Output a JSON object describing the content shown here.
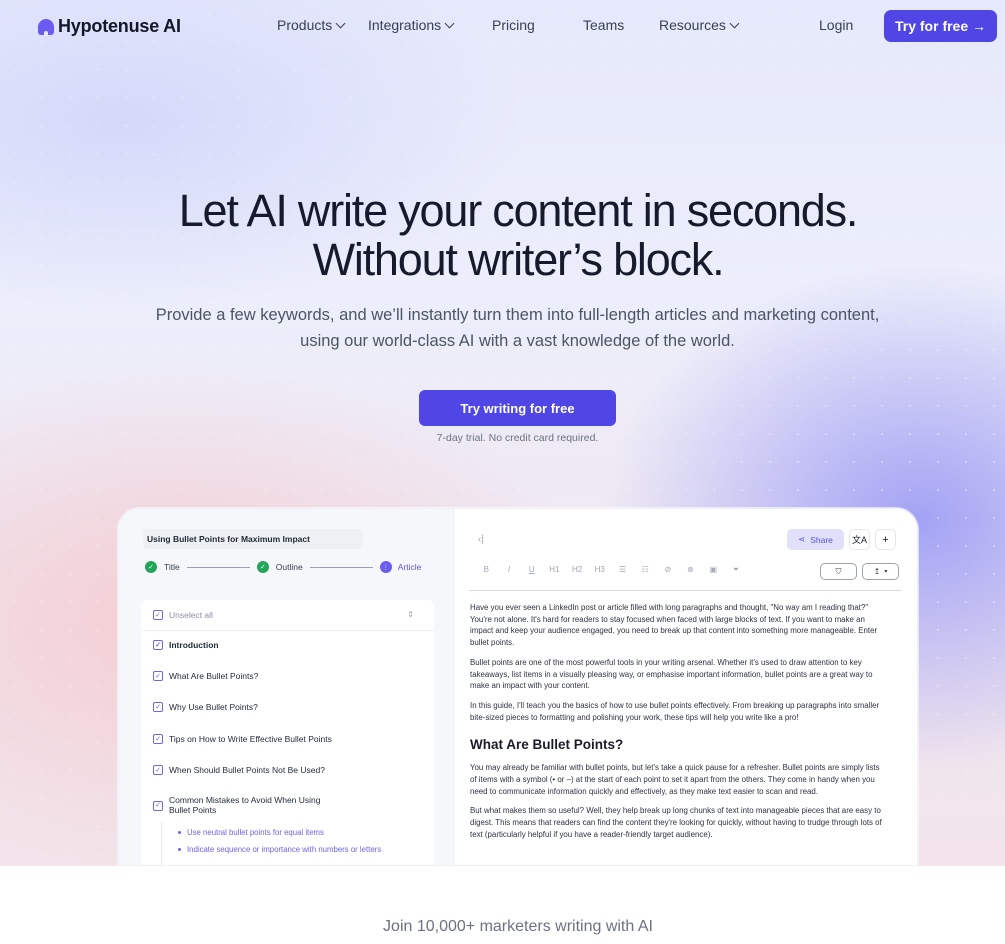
{
  "nav": {
    "logo_text": "Hypotenuse AI",
    "logo_icon": "hypotenuse-logo-icon",
    "items": [
      {
        "label": "Products",
        "dropdown": true
      },
      {
        "label": "Integrations",
        "dropdown": true
      },
      {
        "label": "Pricing",
        "dropdown": false
      },
      {
        "label": "Teams",
        "dropdown": false
      },
      {
        "label": "Resources",
        "dropdown": true
      }
    ],
    "login_label": "Login",
    "try_free_label": "Try for free →"
  },
  "hero": {
    "headline_line1": "Let AI write your content in seconds.",
    "headline_line2": "Without writer’s block.",
    "subhead": "Provide a few keywords, and we’ll instantly turn them into full-length articles and marketing content, using our world-class AI with a vast knowledge of the world.",
    "cta_label": "Try writing for free",
    "cta_note": "7-day trial. No credit card required."
  },
  "app": {
    "doc_title": "Using Bullet Points for Maximum Impact",
    "steps": [
      {
        "label": "Title",
        "state": "done"
      },
      {
        "label": "Outline",
        "state": "done"
      },
      {
        "label": "Article",
        "state": "current"
      }
    ],
    "outline": {
      "unselect_all_label": "Unselect all",
      "items": [
        "Introduction",
        "What Are Bullet Points?",
        "Why Use Bullet Points?",
        "Tips on How to Write Effective Bullet Points",
        "When Should Bullet Points Not Be Used?",
        "Common Mistakes to Avoid When Using Bullet Points"
      ],
      "sub_items": [
        "Use neutral bullet points for equal items",
        "Indicate sequence or importance with numbers or letters"
      ]
    },
    "editor": {
      "share_label": "Share",
      "toolbar": [
        "B",
        "I",
        "U",
        "H1",
        "H2",
        "H3",
        "bullet-list",
        "numbered-list",
        "link",
        "unlink",
        "image",
        "clear-format"
      ],
      "toolbar_glyphs": [
        "B",
        "I",
        "U",
        "H1",
        "H2",
        "H3",
        "☰",
        "☷",
        "⊘",
        "⊗",
        "▣",
        "⏷"
      ],
      "paragraphs_intro": [
        "Have you ever seen a LinkedIn post or article filled with long paragraphs and thought, \"No way am I reading that?\" You're not alone. It's hard for readers to stay focused when faced with large blocks of text. If you want to make an impact and keep your audience engaged, you need to break up that content into something more manageable. Enter bullet points.",
        "Bullet points are one of the most powerful tools in your writing arsenal. Whether it's used to draw attention to key takeaways, list items in a visually pleasing way, or emphasise important information, bullet points are a great way to make an impact with your content.",
        "In this guide, I'll teach you the basics of how to use bullet points effectively. From breaking up paragraphs into smaller bite-sized pieces to formatting and polishing your work, these tips will help you write like a pro!"
      ],
      "heading": "What Are Bullet Points?",
      "paragraphs_section": [
        "You may already be familiar with bullet points, but let's take a quick pause for a refresher. Bullet points are simply lists of items with a symbol (• or –) at the start of each point to set it apart from the others. They come in handy when you need to communicate information quickly and effectively, as they make text easier to scan and read.",
        "But what makes them so useful? Well, they help break up long chunks of text into manageable pieces that are easy to digest. This means that readers can find the content they're looking for quickly, without having to trudge through lots of text (particularly helpful if you have a reader-friendly target audience)."
      ]
    }
  },
  "social_proof": "Join 10,000+ marketers writing with AI",
  "colors": {
    "brand": "#4f46e5",
    "accent_light": "#e0e0fb",
    "success": "#22a559",
    "heading": "#161a2c"
  }
}
